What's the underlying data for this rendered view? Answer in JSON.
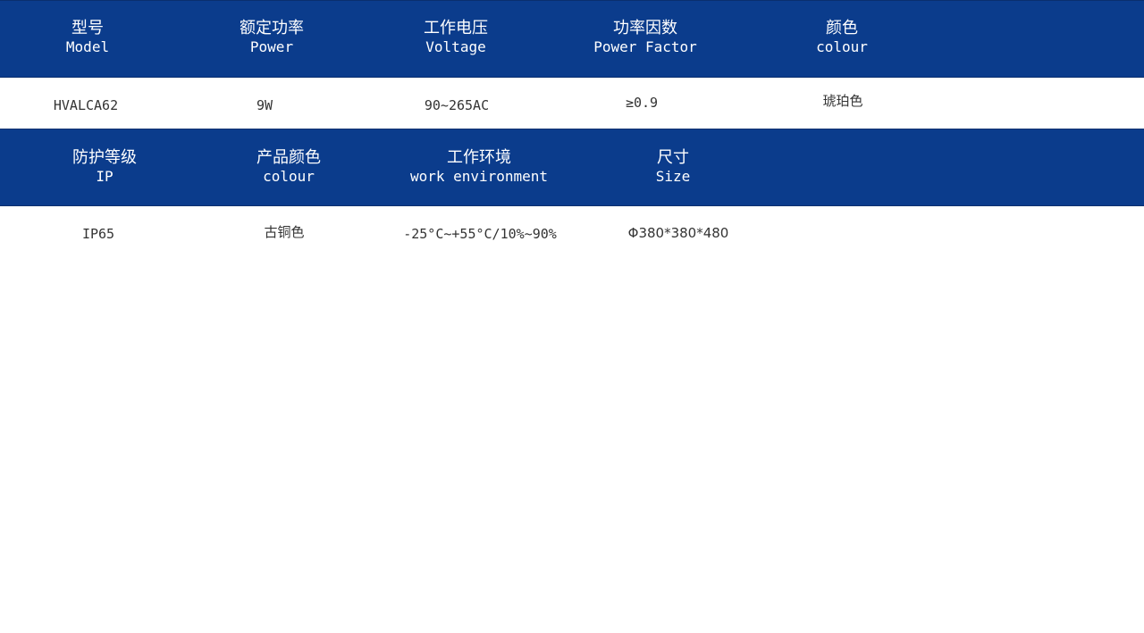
{
  "spec_rows": [
    {
      "headers": [
        {
          "zh": "型号",
          "en": "Model"
        },
        {
          "zh": "额定功率",
          "en": "Power"
        },
        {
          "zh": "工作电压",
          "en": "Voltage"
        },
        {
          "zh": "功率因数",
          "en": "Power Factor"
        },
        {
          "zh": "颜色",
          "en": "colour"
        }
      ],
      "values": [
        "HVALCA62",
        "9W",
        "90~265AC",
        "≥0.9",
        "琥珀色"
      ]
    },
    {
      "headers": [
        {
          "zh": "防护等级",
          "en": "IP"
        },
        {
          "zh": "产品颜色",
          "en": "colour"
        },
        {
          "zh": "工作环境",
          "en": "work environment"
        },
        {
          "zh": "尺寸",
          "en": "Size"
        }
      ],
      "values": [
        "IP65",
        "古铜色",
        "-25°C~+55°C/10%~90%",
        "Φ380*380*480"
      ]
    }
  ],
  "colors": {
    "header_band": "#0b3c8c",
    "header_text": "#ffffff",
    "value_text": "#333333",
    "background": "#ffffff"
  }
}
